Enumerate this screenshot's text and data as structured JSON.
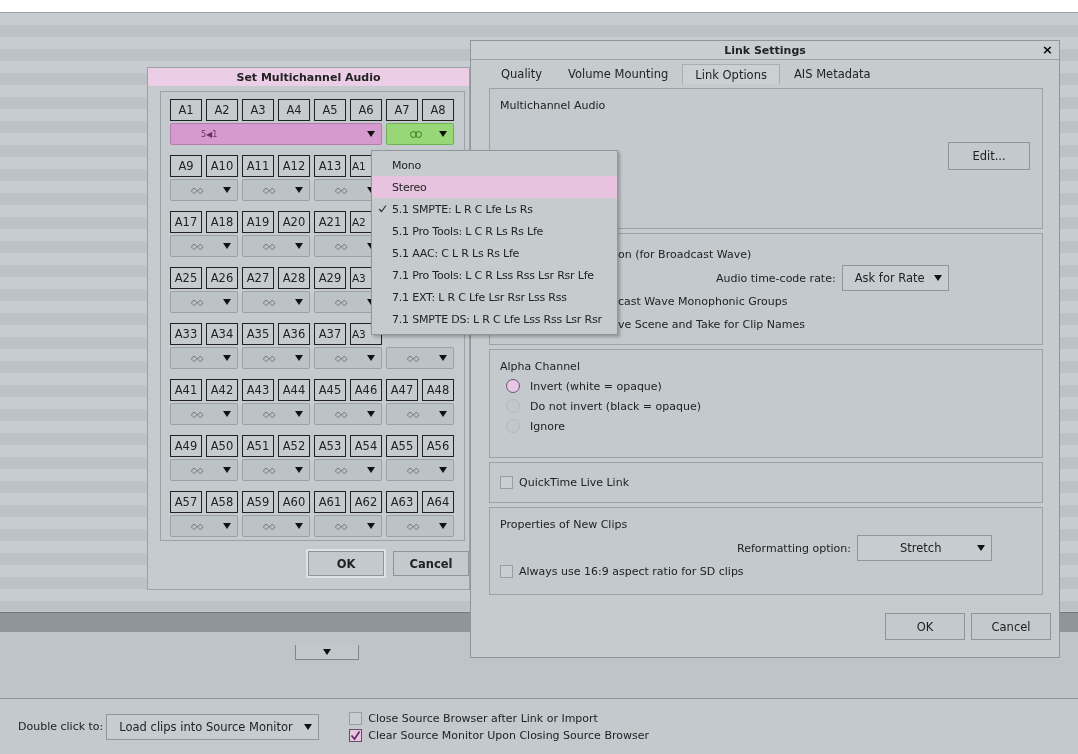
{
  "background": {
    "double_click": {
      "label": "Double click to:",
      "value": "Load clips into Source Monitor"
    },
    "options": [
      {
        "label": "Close Source Browser after Link or Import",
        "checked": false
      },
      {
        "label": "Clear Source Monitor Upon Closing Source Browser",
        "checked": true
      }
    ]
  },
  "link_settings": {
    "title": "Link Settings",
    "close": "×",
    "tabs": [
      {
        "label": "Quality",
        "selected": false
      },
      {
        "label": "Volume Mounting",
        "selected": false
      },
      {
        "label": "Link Options",
        "selected": true
      },
      {
        "label": "AIS Metadata",
        "selected": false
      }
    ],
    "multichannel": {
      "title": "Multichannel Audio",
      "edit_button": "Edit..."
    },
    "broadcast": {
      "line_1": "on (for Broadcast Wave)",
      "rate_label": "Audio time-code rate:",
      "rate_value": "Ask for Rate",
      "line_2": "cast Wave Monophonic Groups",
      "line_3": "ve Scene and Take for Clip Names"
    },
    "alpha": {
      "title": "Alpha Channel",
      "options": [
        {
          "label": "Invert (white = opaque)",
          "selected": true
        },
        {
          "label": "Do not invert (black = opaque)",
          "selected": false
        },
        {
          "label": "Ignore",
          "selected": false
        }
      ]
    },
    "quicktime": {
      "label": "QuickTime Live Link",
      "checked": false
    },
    "new_clips": {
      "title": "Properties of New Clips",
      "reformat_label": "Reformatting option:",
      "reformat_value": "Stretch",
      "aspect": {
        "label": "Always use 16:9 aspect ratio for SD clips",
        "checked": false
      }
    },
    "buttons": [
      "OK",
      "Cancel"
    ]
  },
  "multichannel_dialog": {
    "title": "Set Multichannel Audio",
    "rows": [
      {
        "channels": [
          "A1",
          "A2",
          "A3",
          "A4",
          "A5",
          "A6",
          "A7",
          "A8"
        ],
        "selectors": [
          {
            "kind": "surround",
            "symbol": "5◀1"
          },
          {
            "kind": "linked"
          }
        ]
      },
      {
        "channels": [
          "A9",
          "A10",
          "A11",
          "A12",
          "A13",
          "A1"
        ],
        "selectors": [
          {
            "kind": "pair",
            "symbol": "◇◇"
          },
          {
            "kind": "pair",
            "symbol": "◇◇"
          },
          {
            "kind": "pair",
            "symbol": "◇◇"
          }
        ]
      },
      {
        "channels": [
          "A17",
          "A18",
          "A19",
          "A20",
          "A21",
          "A2"
        ],
        "selectors": [
          {
            "kind": "pair",
            "symbol": "◇◇"
          },
          {
            "kind": "pair",
            "symbol": "◇◇"
          },
          {
            "kind": "pair",
            "symbol": "◇◇"
          }
        ]
      },
      {
        "channels": [
          "A25",
          "A26",
          "A27",
          "A28",
          "A29",
          "A3"
        ],
        "selectors": [
          {
            "kind": "pair",
            "symbol": "◇◇"
          },
          {
            "kind": "pair",
            "symbol": "◇◇"
          },
          {
            "kind": "pair",
            "symbol": "◇◇"
          }
        ]
      },
      {
        "channels": [
          "A33",
          "A34",
          "A35",
          "A36",
          "A37",
          "A3"
        ],
        "selectors": [
          {
            "kind": "pair",
            "symbol": "◇◇"
          },
          {
            "kind": "pair",
            "symbol": "◇◇"
          },
          {
            "kind": "pair",
            "symbol": "◇◇"
          },
          {
            "kind": "pair",
            "symbol": "◇◇"
          }
        ]
      },
      {
        "channels": [
          "A41",
          "A42",
          "A43",
          "A44",
          "A45",
          "A46",
          "A47",
          "A48"
        ],
        "selectors": [
          {
            "kind": "pair",
            "symbol": "◇◇"
          },
          {
            "kind": "pair",
            "symbol": "◇◇"
          },
          {
            "kind": "pair",
            "symbol": "◇◇"
          },
          {
            "kind": "pair",
            "symbol": "◇◇"
          }
        ]
      },
      {
        "channels": [
          "A49",
          "A50",
          "A51",
          "A52",
          "A53",
          "A54",
          "A55",
          "A56"
        ],
        "selectors": [
          {
            "kind": "pair",
            "symbol": "◇◇"
          },
          {
            "kind": "pair",
            "symbol": "◇◇"
          },
          {
            "kind": "pair",
            "symbol": "◇◇"
          },
          {
            "kind": "pair",
            "symbol": "◇◇"
          }
        ]
      },
      {
        "channels": [
          "A57",
          "A58",
          "A59",
          "A60",
          "A61",
          "A62",
          "A63",
          "A64"
        ],
        "selectors": [
          {
            "kind": "pair",
            "symbol": "◇◇"
          },
          {
            "kind": "pair",
            "symbol": "◇◇"
          },
          {
            "kind": "pair",
            "symbol": "◇◇"
          },
          {
            "kind": "pair",
            "symbol": "◇◇"
          }
        ]
      }
    ],
    "buttons": [
      {
        "label": "OK",
        "focused": true
      },
      {
        "label": "Cancel",
        "focused": false
      }
    ]
  },
  "format_menu": {
    "items": [
      {
        "label": "Mono",
        "checked": false,
        "highlighted": false
      },
      {
        "label": "Stereo",
        "checked": false,
        "highlighted": true
      },
      {
        "label": "5.1 SMPTE: L R C Lfe Ls Rs",
        "checked": true,
        "highlighted": false
      },
      {
        "label": "5.1 Pro Tools: L C R Ls Rs Lfe",
        "checked": false,
        "highlighted": false
      },
      {
        "label": "5.1 AAC: C L R Ls Rs Lfe",
        "checked": false,
        "highlighted": false
      },
      {
        "label": "7.1 Pro Tools: L C R Lss Rss Lsr Rsr Lfe",
        "checked": false,
        "highlighted": false
      },
      {
        "label": "7.1 EXT: L R C Lfe Lsr Rsr Lss Rss",
        "checked": false,
        "highlighted": false
      },
      {
        "label": "7.1 SMPTE DS: L R C Lfe Lss Rss Lsr Rsr",
        "checked": false,
        "highlighted": false
      }
    ]
  }
}
